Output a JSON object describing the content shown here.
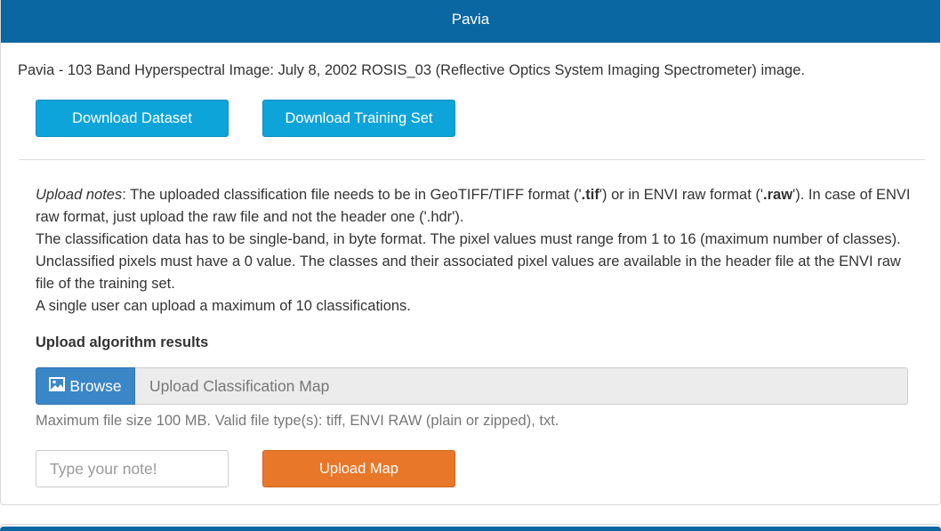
{
  "panel": {
    "title": "Pavia",
    "description": "Pavia - 103 Band Hyperspectral Image: July 8, 2002 ROSIS_03 (Reflective Optics System Imaging Spectrometer) image."
  },
  "buttons": {
    "download_dataset": "Download Dataset",
    "download_training": "Download Training Set",
    "upload_map": "Upload Map",
    "browse": "Browse"
  },
  "notes": {
    "label": "Upload notes",
    "line1_a": ": The uploaded classification file needs to be in GeoTIFF/TIFF format ('",
    "tif": ".tif",
    "line1_b": "') or in ENVI raw format ('",
    "raw": ".raw",
    "line1_c": "'). In case of ENVI raw format, just upload the raw file and not the header one ('.hdr').",
    "line2": "The classification data has to be single-band, in byte format. The pixel values must range from 1 to 16 (maximum number of classes). Unclassified pixels must have a 0 value. The classes and their associated pixel values are available in the header file at the ENVI raw file of the training set.",
    "line3": "A single user can upload a maximum of 10 classifications."
  },
  "upload": {
    "title": "Upload algorithm results",
    "file_placeholder": "Upload Classification Map",
    "hint": "Maximum file size 100 MB. Valid file type(s): tiff, ENVI RAW (plain or zipped), txt.",
    "note_placeholder": "Type your note!"
  },
  "colors": {
    "header": "#0b67a1",
    "primary_button": "#0da4d9",
    "browse_button": "#3a86c7",
    "upload_button": "#e8772a"
  },
  "icons": {
    "browse": "image-icon"
  }
}
